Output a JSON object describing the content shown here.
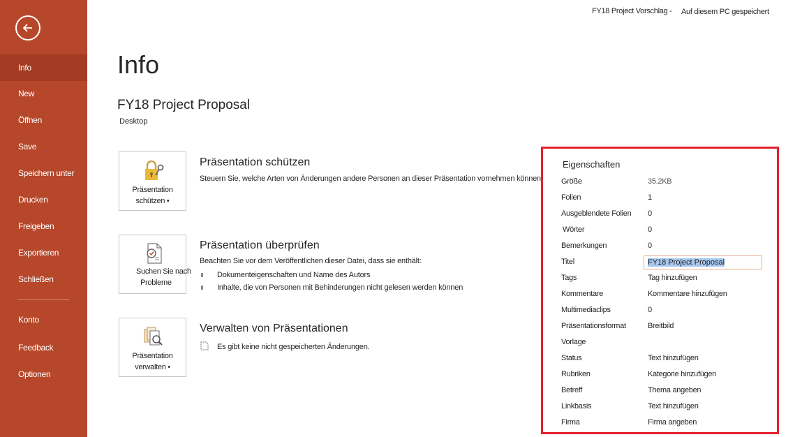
{
  "header": {
    "doc_name": "FY18 Project Vorschlag -",
    "save_location": "Auf diesem PC gespeichert"
  },
  "sidebar": {
    "items": [
      {
        "label": "Info",
        "active": true
      },
      {
        "label": "New"
      },
      {
        "label": "Öffnen"
      },
      {
        "label": "Save"
      },
      {
        "label": "Speichern unter"
      },
      {
        "label": "Drucken"
      },
      {
        "label": "Freigeben"
      },
      {
        "label": "Exportieren"
      },
      {
        "label": "Schließen"
      },
      {
        "label": "Konto"
      },
      {
        "label": "Feedback"
      },
      {
        "label": "Optionen"
      }
    ]
  },
  "main": {
    "page_title": "Info",
    "doc_title": "FY18 Project Proposal",
    "doc_location": "Desktop",
    "sections": [
      {
        "tile_label_1": "Präsentation",
        "tile_label_2": "schützen •",
        "title": "Präsentation schützen",
        "description": "Steuern Sie, welche Arten von Änderungen andere Personen an dieser Präsentation vornehmen können."
      },
      {
        "tile_label_1": "Suchen Sie nach",
        "tile_label_2": "Probleme",
        "title": "Präsentation überprüfen",
        "description": "Beachten Sie vor dem Veröffentlichen dieser Datei, dass sie enthält:",
        "bullets": [
          "Dokumenteigenschaften und Name des Autors",
          "Inhalte, die von Personen mit Behinderungen nicht gelesen werden können"
        ]
      },
      {
        "tile_label_1": "Präsentation",
        "tile_label_2": "verwalten •",
        "title": "Verwalten von Präsentationen",
        "description": "Es gibt keine nicht gespeicherten Änderungen."
      }
    ]
  },
  "properties": {
    "heading": "Eigenschaften",
    "rows": [
      {
        "label": "Größe",
        "value": "35.2KB"
      },
      {
        "label": "Folien",
        "value": "1"
      },
      {
        "label": "Ausgeblendete Folien",
        "value": "0"
      },
      {
        "label": "Wörter",
        "value": "0"
      },
      {
        "label": "Bemerkungen",
        "value": "0"
      },
      {
        "label": "Titel",
        "value": "FY18 Project Proposal"
      },
      {
        "label": "Tags",
        "value": "Tag hinzufügen"
      },
      {
        "label": "Kommentare",
        "value": "Kommentare hinzufügen"
      },
      {
        "label": "Multimediaclips",
        "value": "0"
      },
      {
        "label": "Präsentationsformat",
        "value": "Breitbild"
      },
      {
        "label": "Vorlage",
        "value": ""
      },
      {
        "label": "Status",
        "value": "Text hinzufügen"
      },
      {
        "label": "Rubriken",
        "value": "Kategorie hinzufügen"
      },
      {
        "label": "Betreff",
        "value": "Thema angeben"
      },
      {
        "label": "Linkbasis",
        "value": "Text hinzufügen"
      },
      {
        "label": "Firma",
        "value": "Firma angeben"
      }
    ]
  },
  "colors": {
    "sidebar": "#b7472a",
    "sidebar_active": "#a33b22",
    "highlight_border": "#e3202c"
  }
}
